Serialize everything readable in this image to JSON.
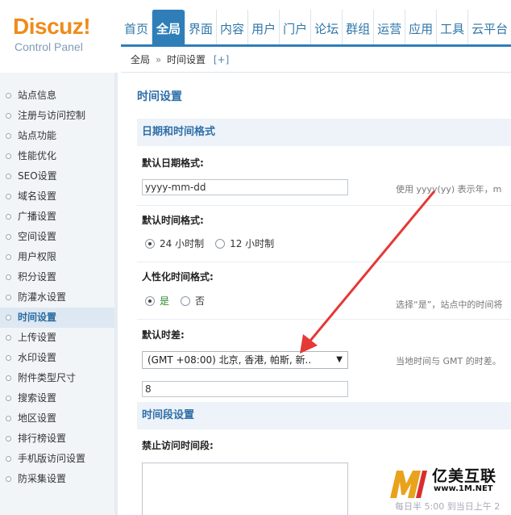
{
  "logo": {
    "main": "Discuz!",
    "sub": "Control Panel"
  },
  "nav": {
    "items": [
      {
        "label": "首页",
        "active": false
      },
      {
        "label": "全局",
        "active": true
      },
      {
        "label": "界面",
        "active": false
      },
      {
        "label": "内容",
        "active": false
      },
      {
        "label": "用户",
        "active": false
      },
      {
        "label": "门户",
        "active": false
      },
      {
        "label": "论坛",
        "active": false
      },
      {
        "label": "群组",
        "active": false
      },
      {
        "label": "运营",
        "active": false
      },
      {
        "label": "应用",
        "active": false
      },
      {
        "label": "工具",
        "active": false
      },
      {
        "label": "云平台",
        "active": false
      }
    ]
  },
  "breadcrumb": {
    "root": "全局",
    "separator": "»",
    "current": "时间设置",
    "plus": "[+]"
  },
  "sidebar": {
    "items": [
      {
        "label": "站点信息"
      },
      {
        "label": "注册与访问控制"
      },
      {
        "label": "站点功能"
      },
      {
        "label": "性能优化"
      },
      {
        "label": "SEO设置"
      },
      {
        "label": "域名设置"
      },
      {
        "label": "广播设置"
      },
      {
        "label": "空间设置"
      },
      {
        "label": "用户权限"
      },
      {
        "label": "积分设置"
      },
      {
        "label": "防灌水设置"
      },
      {
        "label": "时间设置",
        "active": true
      },
      {
        "label": "上传设置"
      },
      {
        "label": "水印设置"
      },
      {
        "label": "附件类型尺寸"
      },
      {
        "label": "搜索设置"
      },
      {
        "label": "地区设置"
      },
      {
        "label": "排行榜设置"
      },
      {
        "label": "手机版访问设置"
      },
      {
        "label": "防采集设置"
      }
    ]
  },
  "main": {
    "page_title": "时间设置",
    "section_datetime": "日期和时间格式",
    "date_format": {
      "label": "默认日期格式:",
      "value": "yyyy-mm-dd",
      "hint": "使用 yyyy(yy) 表示年，m"
    },
    "time_format": {
      "label": "默认时间格式:",
      "options": [
        "24 小时制",
        "12 小时制"
      ],
      "selected": "24 小时制"
    },
    "humanize": {
      "label": "人性化时间格式:",
      "yes": "是",
      "no": "否",
      "selected": "是",
      "hint": "选择“是”，站点中的时间将"
    },
    "timezone": {
      "label": "默认时差:",
      "selected": "(GMT +08:00) 北京, 香港, 帕斯, 新..",
      "hint": "当地时间与 GMT 的时差。"
    },
    "offset_value": "8",
    "section_period": "时间段设置",
    "forbid": {
      "label": "禁止访问时间段:"
    }
  },
  "watermark": {
    "title": "亿美互联",
    "url": "www.1M.NET",
    "ghost_1": "每日半 5:00 到当日上午 2"
  },
  "colors": {
    "accent": "#2f7eb8",
    "logo_orange": "#ef8b1a",
    "arrow_red": "#e53935",
    "yes_green": "#2d8a2d"
  }
}
